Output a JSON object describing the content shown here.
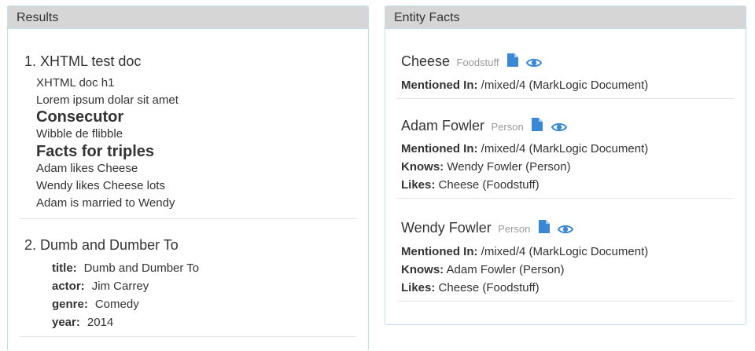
{
  "results_panel": {
    "heading": "Results",
    "results": [
      {
        "title": "1. XHTML test doc",
        "lines": [
          "XHTML doc h1",
          "Lorem ipsum dolar sit amet",
          "Consecutor",
          "Wibble de flibble",
          "Facts for triples",
          "Adam likes Cheese",
          "Wendy likes Cheese lots",
          "Adam is married to Wendy"
        ]
      },
      {
        "title": "2. Dumb and Dumber To",
        "fields": [
          {
            "key": "title:",
            "value": "Dumb and Dumber To"
          },
          {
            "key": "actor:",
            "value": "Jim Carrey"
          },
          {
            "key": "genre:",
            "value": "Comedy"
          },
          {
            "key": "year:",
            "value": "2014"
          }
        ]
      }
    ]
  },
  "facts_panel": {
    "heading": "Entity Facts",
    "entities": [
      {
        "name": "Cheese",
        "type": "Foodstuff",
        "facts": [
          {
            "key": "Mentioned In:",
            "value": " /mixed/4 (MarkLogic Document)"
          }
        ]
      },
      {
        "name": "Adam Fowler",
        "type": "Person",
        "facts": [
          {
            "key": "Mentioned In:",
            "value": " /mixed/4 (MarkLogic Document)"
          },
          {
            "key": "Knows:",
            "value": " Wendy Fowler (Person)"
          },
          {
            "key": "Likes:",
            "value": " Cheese (Foodstuff)"
          }
        ]
      },
      {
        "name": "Wendy Fowler",
        "type": "Person",
        "facts": [
          {
            "key": "Mentioned In:",
            "value": " /mixed/4 (MarkLogic Document)"
          },
          {
            "key": "Knows:",
            "value": " Adam Fowler (Person)"
          },
          {
            "key": "Likes:",
            "value": " Cheese (Foodstuff)"
          }
        ]
      }
    ],
    "icons": {
      "document": "document-icon",
      "view": "eye-icon",
      "color": "#3a87d6"
    }
  }
}
